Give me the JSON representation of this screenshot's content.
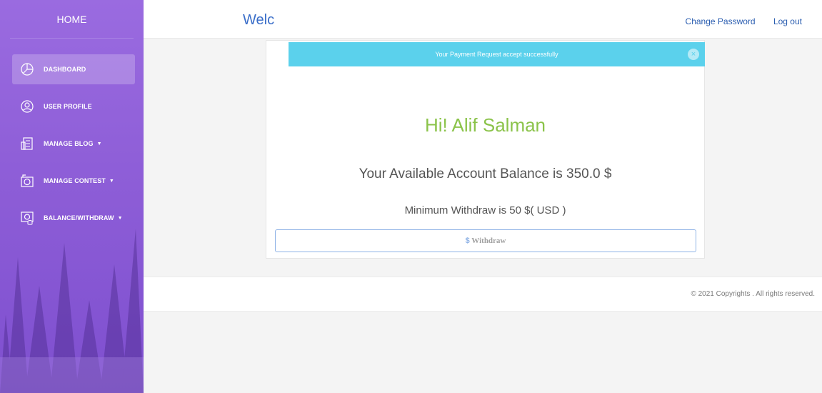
{
  "sidebar": {
    "title": "HOME",
    "items": [
      {
        "label": "DASHBOARD",
        "icon": "pie-chart-icon",
        "active": true,
        "dropdown": false
      },
      {
        "label": "USER PROFILE",
        "icon": "user-icon",
        "active": false,
        "dropdown": false
      },
      {
        "label": "MANAGE BLOG",
        "icon": "blog-icon",
        "active": false,
        "dropdown": true
      },
      {
        "label": "MANAGE CONTEST",
        "icon": "camera-icon",
        "active": false,
        "dropdown": true
      },
      {
        "label": "BALANCE/WITHDRAW",
        "icon": "wallet-icon",
        "active": false,
        "dropdown": true
      }
    ],
    "caret": "▼"
  },
  "topbar": {
    "brand": "Welc",
    "change_password": "Change Password",
    "logout": "Log out"
  },
  "alert": {
    "message": "Your Payment Request accept successfully",
    "close": "×"
  },
  "main": {
    "greeting": "Hi! Alif Salman",
    "balance_text": "Your Available Account Balance is 350.0 $",
    "min_withdraw": "Minimum Withdraw is 50 $( USD )",
    "withdraw_symbol": "$",
    "withdraw_label": "Withdraw"
  },
  "footer": {
    "copyright": "© 2021 Copyrights . All rights reserved."
  },
  "colors": {
    "sidebar": "#8f5fd8",
    "alert": "#5bd1ec",
    "greeting": "#8bc34a",
    "link": "#2a5db0"
  }
}
